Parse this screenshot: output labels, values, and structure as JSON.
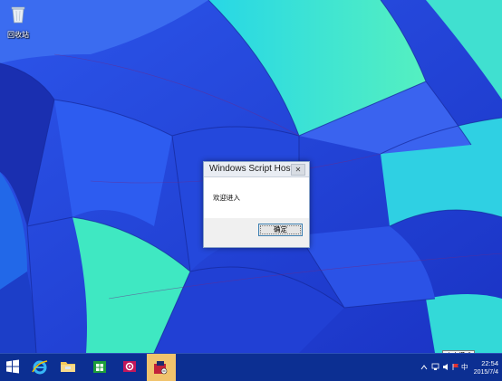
{
  "desktop": {
    "icons": [
      {
        "label": "回收站",
        "icon": "recycle-bin-icon"
      }
    ]
  },
  "dialog": {
    "title": "Windows Script Host",
    "close_glyph": "✕",
    "message": "欢迎进入",
    "ok_label": "确定"
  },
  "taskbar": {
    "items": [
      {
        "name": "start-button",
        "icon": "windows-logo-icon"
      },
      {
        "name": "internet-explorer",
        "icon": "ie-icon"
      },
      {
        "name": "file-explorer",
        "icon": "folder-icon"
      },
      {
        "name": "store",
        "icon": "store-icon"
      },
      {
        "name": "media",
        "icon": "media-icon"
      },
      {
        "name": "script-host",
        "icon": "script-icon",
        "active": true
      }
    ],
    "ime_tooltip": "中文模式",
    "ime_mode": "中",
    "clock": {
      "time": "22:54",
      "date": "2015/7/4"
    }
  },
  "colors": {
    "taskbar_bg": "#0c2f92",
    "active_item": "#f0c36d",
    "wallpaper_blue": "#2a4ee6",
    "wallpaper_cyan": "#3fe6c8"
  }
}
